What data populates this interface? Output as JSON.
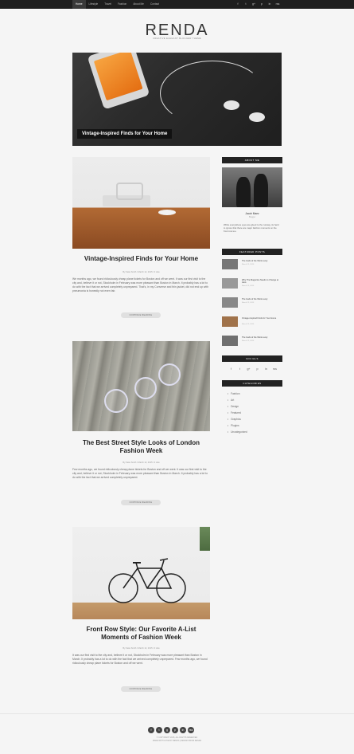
{
  "nav": {
    "items": [
      "Home",
      "Lifestyle",
      "Travel",
      "Fashion",
      "About Me",
      "Contact"
    ]
  },
  "top_social": {
    "icons": [
      "f",
      "t",
      "g+",
      "p",
      "in",
      "rss"
    ]
  },
  "logo": "RENDA",
  "tagline": "CREATIVE ELEGANT BLOGGER THEME",
  "hero": {
    "caption": "Vintage-Inspired Finds for Your Home"
  },
  "posts": [
    {
      "title": "Vintage-Inspired Finds for Your Home",
      "meta": "By Katie Smith  /  March 12, 2015  /  0 Like",
      "excerpt": "We months ago, we found ridiculously cheap plane tickets for Boston and off we went. It was our first visit to the city and, believe it or not, Stockholm in February was more pleasant than Boston in March. It probably has a lot to do with the fact that we arrived completely unprepared. That's, in my Converse and thin jacket, did not end up with pneumonia is honestly not even fair.",
      "button": "CONTINUE READING"
    },
    {
      "title": "The Best Street Style Looks of London Fashion Week",
      "meta": "By Katie Smith  /  March 12, 2015  /  0 Like",
      "excerpt": "Few months ago, we found ridiculously cheap plane tickets for Boston and off we went. It was our first visit to the city and, believe it or not, Stockholm in February was more pleasant than Boston in March. It probably has a lot to do with the fact that we arrived completely unprepared.",
      "button": "CONTINUE READING"
    },
    {
      "title": "Front Row Style: Our Favorite A-List Moments of Fashion Week",
      "meta": "By Katie Smith  /  March 12, 2015  /  0 Like",
      "excerpt": "It was our first visit to the city and, believe it or not, Stockholm in February was more pleasant than Boston in March. It probably has a lot to do with the fact that we arrived completely unprepared. Few months ago, we found ridiculously cheap plane tickets for Boston and off we went.",
      "button": "CONTINUE READING"
    }
  ],
  "sidebar": {
    "about_header": "ABOUT ME",
    "about_name": "Jacob Maez",
    "about_sub": "Blogger",
    "about_text": "While everywhere eyes are glued to the runway, its hard to ignore that there are major fashion moments on the front row too.",
    "featured_header": "FEATURED POSTS",
    "featured": [
      {
        "title": "The Gods of the Work-Lusty",
        "date": "March 12, 2015"
      },
      {
        "title": "Why The Magazine Needs to Change at Here",
        "date": "March 12, 2015"
      },
      {
        "title": "The Gods of the Work-Lusty",
        "date": "March 12, 2015"
      },
      {
        "title": "Vintage-Inspired Finds for Your Home",
        "date": "March 12, 2015"
      },
      {
        "title": "The Gods of the Work-Lusty",
        "date": "March 12, 2015"
      }
    ],
    "social_header": "SOCIALS",
    "social_icons": [
      "f",
      "t",
      "g+",
      "p",
      "in",
      "rss"
    ],
    "categories_header": "CATEGORIES",
    "categories": [
      "Fashion",
      "Art",
      "Design",
      "Featured",
      "Graphics",
      "Plugins",
      "Uncategorized"
    ]
  },
  "footer": {
    "icons": [
      "f",
      "t",
      "g",
      "p",
      "in",
      "rss"
    ],
    "line1": "© COPYRIGHT 2015, ALL RIGHTS RESERVED",
    "line2": "MADE WITH LOVE BY RENDA  |  DESIGN FROM RENDA"
  }
}
